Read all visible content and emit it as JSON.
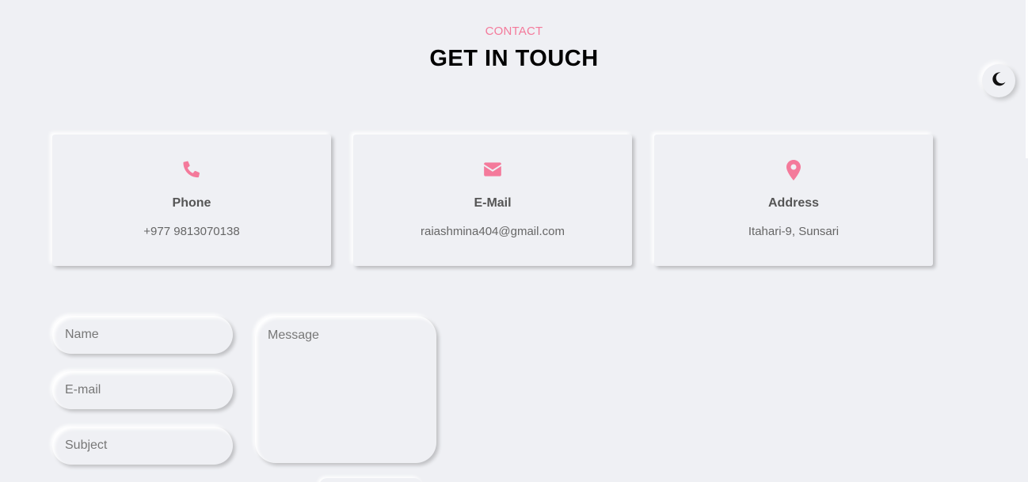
{
  "header": {
    "subtitle": "CONTACT",
    "title": "GET IN TOUCH"
  },
  "theme_toggle": {
    "icon": "moon-icon"
  },
  "cards": [
    {
      "icon": "phone-icon",
      "label": "Phone",
      "value": "+977 9813070138"
    },
    {
      "icon": "envelope-icon",
      "label": "E-Mail",
      "value": "raiashmina404@gmail.com"
    },
    {
      "icon": "map-pin-icon",
      "label": "Address",
      "value": "Itahari-9, Sunsari"
    }
  ],
  "form": {
    "name_placeholder": "Name",
    "email_placeholder": "E-mail",
    "subject_placeholder": "Subject",
    "message_placeholder": "Message"
  },
  "colors": {
    "accent": "#f47a9b",
    "background": "#eff0f4"
  }
}
